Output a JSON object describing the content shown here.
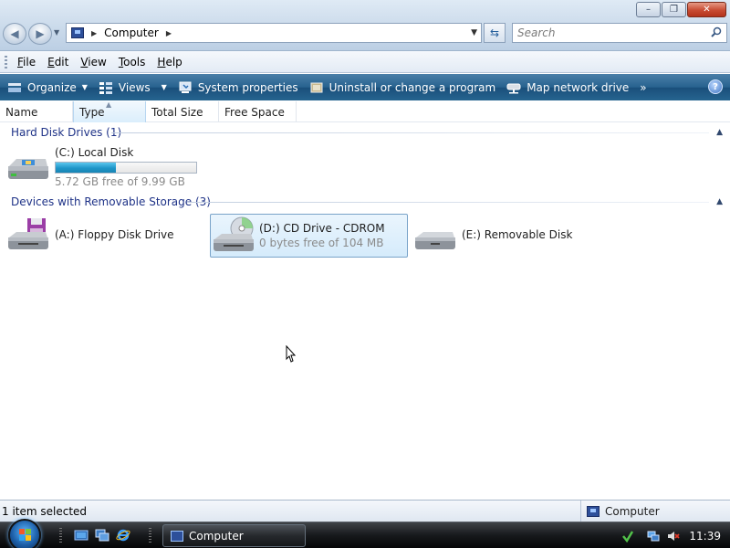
{
  "window": {
    "minimize_glyph": "–",
    "maximize_glyph": "❐",
    "close_glyph": "✕"
  },
  "address": {
    "path_text": "Computer",
    "search_placeholder": "Search"
  },
  "menu": {
    "items": [
      "File",
      "Edit",
      "View",
      "Tools",
      "Help"
    ]
  },
  "commandbar": {
    "organize": "Organize",
    "views": "Views",
    "system_properties": "System properties",
    "uninstall": "Uninstall or change a program",
    "map_network_drive": "Map network drive",
    "more_glyph": "»",
    "help_glyph": "?"
  },
  "columns": {
    "name": "Name",
    "type": "Type",
    "total_size": "Total Size",
    "free_space": "Free Space"
  },
  "groups": {
    "hard_disk": {
      "title": "Hard Disk Drives (1)",
      "drives": [
        {
          "name": "(C:) Local Disk",
          "free_text": "5.72 GB free of 9.99 GB",
          "used_fraction": 0.43
        }
      ]
    },
    "removable": {
      "title": "Devices with Removable Storage (3)",
      "drives": [
        {
          "name": "(A:) Floppy Disk Drive"
        },
        {
          "name": "(D:) CD Drive - CDROM",
          "free_text": "0 bytes free of 104 MB"
        },
        {
          "name": "(E:) Removable Disk"
        }
      ]
    }
  },
  "statusbar": {
    "selection": "1 item selected",
    "location": "Computer"
  },
  "taskbar": {
    "window_button": "Computer",
    "clock": "11:39"
  },
  "colors": {
    "group_header": "#1e3287",
    "commandbar": "#27628f",
    "capacity_fill": "#1f96c8",
    "selection_border": "#79a3c9"
  }
}
